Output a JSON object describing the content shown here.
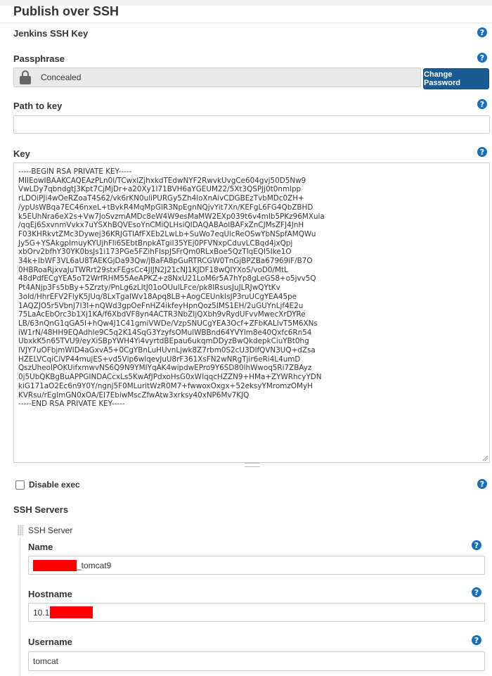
{
  "section": {
    "title": "Publish over SSH"
  },
  "jenkins_ssh_key": {
    "label": "Jenkins SSH Key",
    "help": "?"
  },
  "passphrase": {
    "label": "Passphrase",
    "help": "?",
    "value": "Concealed",
    "change_button": "Change Password"
  },
  "path_to_key": {
    "label": "Path to key",
    "help": "?",
    "value": ""
  },
  "key": {
    "label": "Key",
    "help": "?",
    "lines": [
      "-----BEGIN RSA PRIVATE KEY-----",
      "MIIEowIBAAKCAQEAzPLn0l/TCwxlZjhxkdTEdwNYF2RwvkUvgCe604gvj50D5Nw9",
      "VwLDy7qbndgtJ3Kpt7CjMjDr+a20Xy1I71BVH6aYGEUM22/5Xt3QSPJj0t0nmlpp",
      "rLDOiPJi4wOeRZoaT4S62/vk6rKN0uliPURGy5Zh4loXnAivCDGBEzTvbMDc0ZH+",
      "/ypUsWBqa7EC46nxeL+tBvkR4MqMpGiR3NpEgnNQjvYit7Xn/KEFgL6FG4QbZBHD",
      "k5EUhNra6eX2s+Vw7JoSvzmAMDc8eW4W9esMaMW2EXp039t6v4mIb5PKz96MXula",
      "/qqEj6SxvnmVvkx7uYSXhBQVEsoYnCMiQLHsiQIDAQABAoIBAFxZnCJMsZFJ4JnH",
      "F03KHRkvtZMc3Dywej36KRJGTIAfFXEb2LwLb+SuWo7eqUlcReOSwYbNSpfAMQWu",
      "Jy5G+YSAkgpImuyKYUjhFli6SEbtBnpkATgiI35YEj0PFVNxpCduvLCBqd4jxQpj",
      "xbOrv2bfhY30YK0bsJs1i173PGe5FZihFIspJSFrQm0RLxBoe5QzTIqEQI5Ike1O",
      "34k+IbWF3VL6aU8TAEKGjDa93Qw/jBaFA8pGuRTRCGW0TnGjBPZBa67969iF/B7O",
      "0HBRoaRjxvaJuTWRrt29stxFEgsCc4JIJN2J21cNJ1KJDF18wQIYXoS/voD0/MtL",
      "48dPdfECgYEA5oT2WrfRHM55AeAPKZ+z8NxU21LoM6r5A7hYp8gLeGS8+o5jvv5Q",
      "Pt4ANjp3Fs5bBy+5Zrzty/PnLg6zLItJ01oOUulLFce/pk8IRsusJuJLRJwQYtKv",
      "3old/HhrEFV2FlyK5JUq/8LxTgaIWv18Apq8LB+AogCEUnkIsJP3ruUCgYEA45pe",
      "1AQZJO5r5VbnJ7I3I+nQWd3gpOeFnHZ4ikfeyHpnQoz5IMS1EH/2uGUYnLjf4E2u",
      "75LaAcEbOrc3b1Xj1KA/f6XbdVF8yn4ACTR3NbZIjQXbh9vRydUFvvMwecXrDYRe",
      "LB/63nQnG1qGA5I+hQw4J1C41gmiVWDe/VzpSNUCgYEA3Ocf+ZFbKALIvT5M6XNs",
      "iW1rN/48HH9EQAdhle9C5q2K14SqG3YzyfsOMulWBBnd64YVYlm8e40Qxfc6Rn54",
      "UbxkK5n65TVU9/eyXiSBpYWH4Yi4vyrtdBEpau6ukqmDDyzBwQkdepkCiuYBt0hg",
      "lVJY7uOFbjmWID4aGxvA5+0CgYBnLuHUvnLjwk8Z7rbm0S2cU3DlfQVN3UQ+dZsa",
      "HZELVCqiCiVP44mujES+vd5Vlp6wlqevJuU8rF361XsFN2wNRgTjir6eRi4L4umD",
      "QszUheoIPOKUifxmwvNS6Q9N9YMIYqAK4wipdwEPro9Y6SD80lhWwoq5Ri7ZBAyz",
      "0j5UbQKBgBuAPPGINDACcxLs5KwAfJPdxoHsG0xWIqqcHZZN9+HMa+ZYWRhcyYDN",
      "kiG171aO2Ec6n9Y0Y/ngnj5F0MLuritWzR0M7+fwwoxOxgx+52eksyYMromzOMyH",
      "KVRsu/rEgImGN0xOA/EI7EbiwMscZfwAtw3xrksy40xNP6Mv7KJQ",
      "-----END RSA PRIVATE KEY-----"
    ]
  },
  "disable_exec": {
    "label": "Disable exec",
    "checked": false,
    "help": "?"
  },
  "ssh_servers": {
    "label": "SSH Servers",
    "server": {
      "header": "SSH Server",
      "name": {
        "label": "Name",
        "value": "_tomcat9",
        "help": "?"
      },
      "hostname": {
        "label": "Hostname",
        "value": "10.1",
        "help": "?"
      },
      "username": {
        "label": "Username",
        "value": "tomcat",
        "help": "?"
      }
    }
  }
}
